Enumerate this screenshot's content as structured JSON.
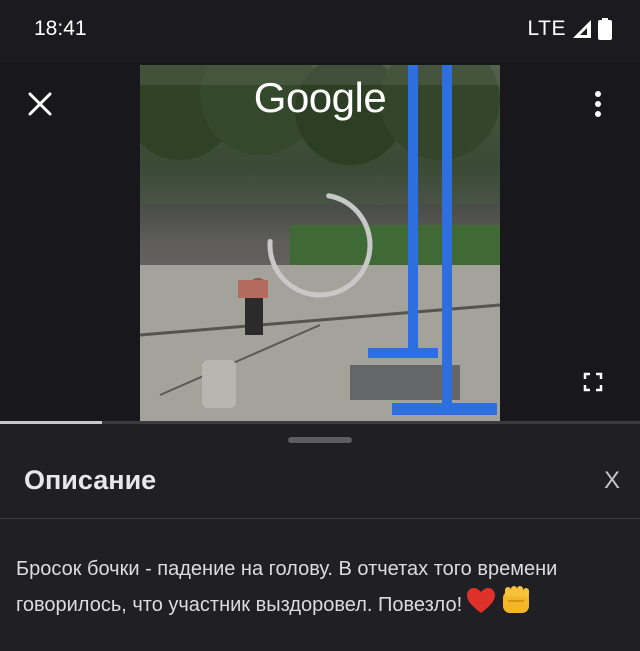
{
  "status_bar": {
    "time": "18:41",
    "network": "LTE",
    "icons": [
      "signal-icon",
      "battery-icon"
    ]
  },
  "video": {
    "logo_text": "Google",
    "loading": true,
    "progress_fraction": 0.16,
    "icons": [
      "close-icon",
      "more-vert-icon",
      "fullscreen-icon",
      "loading-spinner-icon"
    ]
  },
  "sheet": {
    "title": "Описание",
    "close_label": "X",
    "description": "Бросок бочки - падение на голову. В отчетах того времени говорилось, что участник выздоровел. Повезло!",
    "emojis": [
      "red-heart-emoji",
      "fist-emoji"
    ]
  },
  "colors": {
    "background": "#1d1d22",
    "sheet": "#202024",
    "accent_blue": "#2e6fe0"
  }
}
